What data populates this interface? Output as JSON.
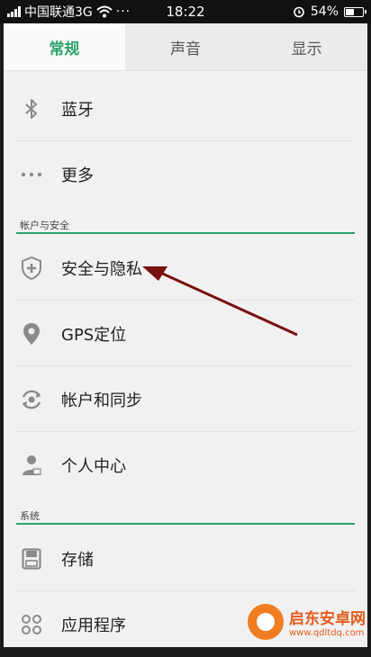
{
  "status": {
    "carrier": "中国联通3G",
    "time": "18:22",
    "battery": "54%",
    "battery_level": 0.54,
    "icons": [
      "signal-icon",
      "wifi-icon",
      "more-icon",
      "alarm-icon",
      "battery-icon"
    ]
  },
  "tabs": [
    {
      "label": "常规",
      "active": true
    },
    {
      "label": "声音",
      "active": false
    },
    {
      "label": "显示",
      "active": false
    }
  ],
  "items_top": [
    {
      "label": "蓝牙",
      "icon": "bluetooth-icon"
    },
    {
      "label": "更多",
      "icon": "more-dots-icon"
    }
  ],
  "section_account": "帐户与安全",
  "items_account": [
    {
      "label": "安全与隐私",
      "icon": "shield-icon"
    },
    {
      "label": "GPS定位",
      "icon": "location-pin-icon"
    },
    {
      "label": "帐户和同步",
      "icon": "sync-icon"
    },
    {
      "label": "个人中心",
      "icon": "person-icon"
    }
  ],
  "section_system": "系统",
  "items_system": [
    {
      "label": "存储",
      "icon": "storage-icon"
    },
    {
      "label": "应用程序",
      "icon": "apps-icon"
    }
  ],
  "watermark": {
    "name": "启东安卓网",
    "url": "www.qdltdq.com"
  },
  "colors": {
    "accent": "#2aa36b",
    "arrow": "#7a1010",
    "watermark": "#e45a1a"
  }
}
